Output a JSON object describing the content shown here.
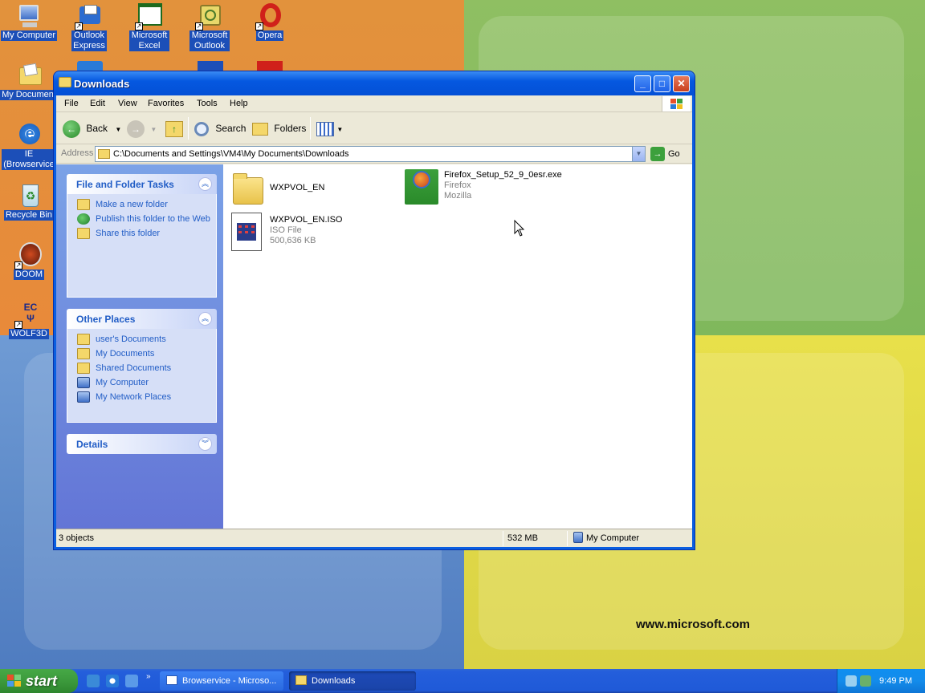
{
  "desktop": {
    "icons": [
      {
        "label": "My Computer",
        "icon": "my-computer-icon"
      },
      {
        "label": "Outlook Express",
        "icon": "outlook-express-icon"
      },
      {
        "label": "Microsoft Excel",
        "icon": "excel-icon"
      },
      {
        "label": "Microsoft Outlook",
        "icon": "outlook-icon"
      },
      {
        "label": "Opera",
        "icon": "opera-icon"
      },
      {
        "label": "My Document",
        "icon": "my-documents-icon"
      },
      {
        "label": "IE (Browservice",
        "icon": "ie-icon"
      },
      {
        "label": "Recycle Bin",
        "icon": "recycle-bin-icon"
      },
      {
        "label": "DOOM",
        "icon": "doom-icon"
      },
      {
        "label": "WOLF3D",
        "icon": "wolf3d-icon"
      }
    ],
    "watermark": "www.microsoft.com"
  },
  "window": {
    "title": "Downloads",
    "menu": [
      "File",
      "Edit",
      "View",
      "Favorites",
      "Tools",
      "Help"
    ],
    "toolbar": {
      "back": "Back",
      "search": "Search",
      "folders": "Folders"
    },
    "address": {
      "label": "Address",
      "value": "C:\\Documents and Settings\\VM4\\My Documents\\Downloads",
      "go": "Go"
    },
    "tasks_panel": {
      "title": "File and Folder Tasks",
      "items": [
        "Make a new folder",
        "Publish this folder to the Web",
        "Share this folder"
      ]
    },
    "places_panel": {
      "title": "Other Places",
      "items": [
        "user's Documents",
        "My Documents",
        "Shared Documents",
        "My Computer",
        "My Network Places"
      ]
    },
    "details_panel": {
      "title": "Details"
    },
    "files": [
      {
        "name": "WXPVOL_EN",
        "line2": "",
        "line3": "",
        "icon": "folder-icon"
      },
      {
        "name": "Firefox_Setup_52_9_0esr.exe",
        "line2": "Firefox",
        "line3": "Mozilla",
        "icon": "firefox-installer-icon"
      },
      {
        "name": "WXPVOL_EN.ISO",
        "line2": "ISO File",
        "line3": "500,636 KB",
        "icon": "iso-file-icon"
      }
    ],
    "status": {
      "objects": "3 objects",
      "size": "532 MB",
      "zone": "My Computer"
    }
  },
  "taskbar": {
    "start": "start",
    "tasks": [
      {
        "label": "Browservice - Microso...",
        "active": false
      },
      {
        "label": "Downloads",
        "active": true
      }
    ],
    "clock": "9:49 PM"
  },
  "colors": {
    "title_blue": "#0558e0",
    "panel_link": "#215dc6",
    "start_green": "#3c9a3c",
    "taskbar_blue": "#245edb"
  }
}
